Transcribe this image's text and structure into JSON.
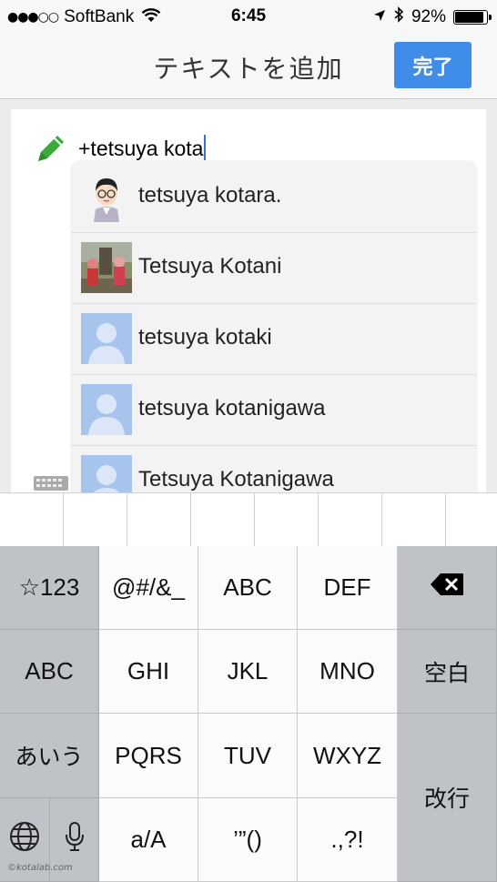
{
  "status_bar": {
    "signal": "●●●○○",
    "carrier": "SoftBank",
    "time": "6:45",
    "battery": "92%",
    "battery_level": 0.92
  },
  "nav": {
    "title": "テキストを追加",
    "done": "完了",
    "accent": "#3f8de8"
  },
  "editor": {
    "text": "+tetsuya kota",
    "edit_icon": "pencil-icon"
  },
  "suggestions": [
    {
      "name": "tetsuya kotara.",
      "avatar": "cartoon-avatar"
    },
    {
      "name": "Tetsuya Kotani",
      "avatar": "photo-avatar"
    },
    {
      "name": "tetsuya kotaki",
      "avatar": "default-person-avatar"
    },
    {
      "name": "tetsuya kotanigawa",
      "avatar": "default-person-avatar"
    },
    {
      "name": "Tetsuya Kotanigawa",
      "avatar": "default-person-avatar"
    }
  ],
  "keyboard": {
    "row1": [
      "☆123",
      "@#/&_",
      "ABC",
      "DEF"
    ],
    "row2": [
      "ABC",
      "GHI",
      "JKL",
      "MNO",
      "空白"
    ],
    "row3": [
      "あいう",
      "PQRS",
      "TUV",
      "WXYZ"
    ],
    "row4": [
      "a/A",
      "’”()",
      ".,?!"
    ],
    "return_label": "改行",
    "delete_icon": "backspace-icon",
    "globe_icon": "globe-icon",
    "mic_icon": "microphone-icon"
  },
  "watermark": "©kotalab.com"
}
